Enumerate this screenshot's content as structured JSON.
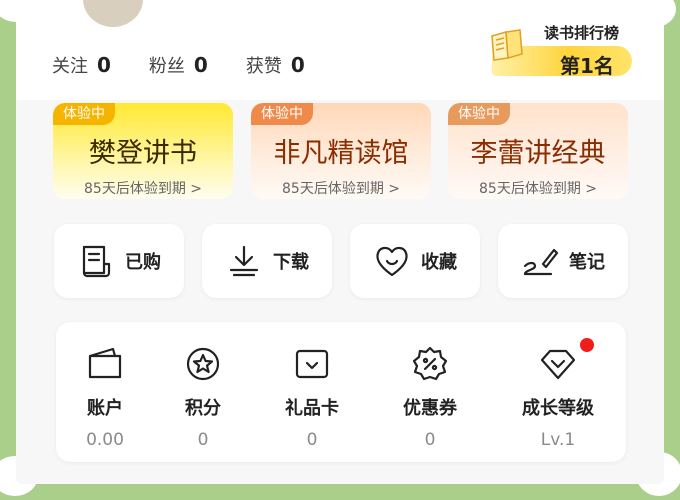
{
  "stats": [
    {
      "label": "关注",
      "value": "0"
    },
    {
      "label": "粉丝",
      "value": "0"
    },
    {
      "label": "获赞",
      "value": "0"
    }
  ],
  "rank": {
    "title": "读书排行榜",
    "value": "第1名"
  },
  "cards": [
    {
      "tag": "体验中",
      "name": "樊登讲书",
      "expire": "85天后体验到期 >"
    },
    {
      "tag": "体验中",
      "name": "非凡精读馆",
      "expire": "85天后体验到期 >"
    },
    {
      "tag": "体验中",
      "name": "李蕾讲经典",
      "expire": "85天后体验到期 >"
    }
  ],
  "quick": [
    {
      "label": "已购",
      "icon": "receipt-icon"
    },
    {
      "label": "下载",
      "icon": "download-icon"
    },
    {
      "label": "收藏",
      "icon": "heart-icon"
    },
    {
      "label": "笔记",
      "icon": "pen-note-icon"
    }
  ],
  "wallet": [
    {
      "label": "账户",
      "value": "0.00",
      "icon": "wallet-icon"
    },
    {
      "label": "积分",
      "value": "0",
      "icon": "points-star-icon"
    },
    {
      "label": "礼品卡",
      "value": "0",
      "icon": "gift-card-icon"
    },
    {
      "label": "优惠券",
      "value": "0",
      "icon": "coupon-icon"
    },
    {
      "label": "成长等级",
      "value": "Lv.1",
      "icon": "level-icon"
    }
  ],
  "colors": {
    "background": "#a9cf8a",
    "accent": "#f01d1d",
    "rank_yellow": "#ffd43b"
  }
}
